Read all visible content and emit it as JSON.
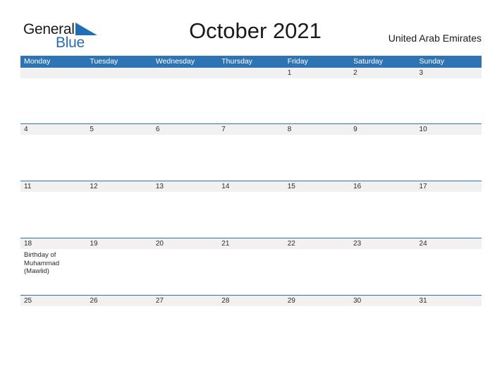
{
  "logo": {
    "word_one": "General",
    "word_two": "Blue",
    "flag_icon": "blue-triangle-flag-icon",
    "color_dark": "#1a1a1a",
    "color_blue": "#2a6cb0"
  },
  "header": {
    "title": "October 2021",
    "region": "United Arab Emirates"
  },
  "calendar": {
    "header_bg": "#2e74b5",
    "date_row_bg": "#f1f1f1",
    "weekdays": [
      "Monday",
      "Tuesday",
      "Wednesday",
      "Thursday",
      "Friday",
      "Saturday",
      "Sunday"
    ],
    "weeks": [
      {
        "days": [
          {
            "date": "",
            "event": ""
          },
          {
            "date": "",
            "event": ""
          },
          {
            "date": "",
            "event": ""
          },
          {
            "date": "",
            "event": ""
          },
          {
            "date": "1",
            "event": ""
          },
          {
            "date": "2",
            "event": ""
          },
          {
            "date": "3",
            "event": ""
          }
        ]
      },
      {
        "days": [
          {
            "date": "4",
            "event": ""
          },
          {
            "date": "5",
            "event": ""
          },
          {
            "date": "6",
            "event": ""
          },
          {
            "date": "7",
            "event": ""
          },
          {
            "date": "8",
            "event": ""
          },
          {
            "date": "9",
            "event": ""
          },
          {
            "date": "10",
            "event": ""
          }
        ]
      },
      {
        "days": [
          {
            "date": "11",
            "event": ""
          },
          {
            "date": "12",
            "event": ""
          },
          {
            "date": "13",
            "event": ""
          },
          {
            "date": "14",
            "event": ""
          },
          {
            "date": "15",
            "event": ""
          },
          {
            "date": "16",
            "event": ""
          },
          {
            "date": "17",
            "event": ""
          }
        ]
      },
      {
        "days": [
          {
            "date": "18",
            "event": "Birthday of Muhammad (Mawlid)"
          },
          {
            "date": "19",
            "event": ""
          },
          {
            "date": "20",
            "event": ""
          },
          {
            "date": "21",
            "event": ""
          },
          {
            "date": "22",
            "event": ""
          },
          {
            "date": "23",
            "event": ""
          },
          {
            "date": "24",
            "event": ""
          }
        ]
      },
      {
        "days": [
          {
            "date": "25",
            "event": ""
          },
          {
            "date": "26",
            "event": ""
          },
          {
            "date": "27",
            "event": ""
          },
          {
            "date": "28",
            "event": ""
          },
          {
            "date": "29",
            "event": ""
          },
          {
            "date": "30",
            "event": ""
          },
          {
            "date": "31",
            "event": ""
          }
        ]
      }
    ]
  }
}
